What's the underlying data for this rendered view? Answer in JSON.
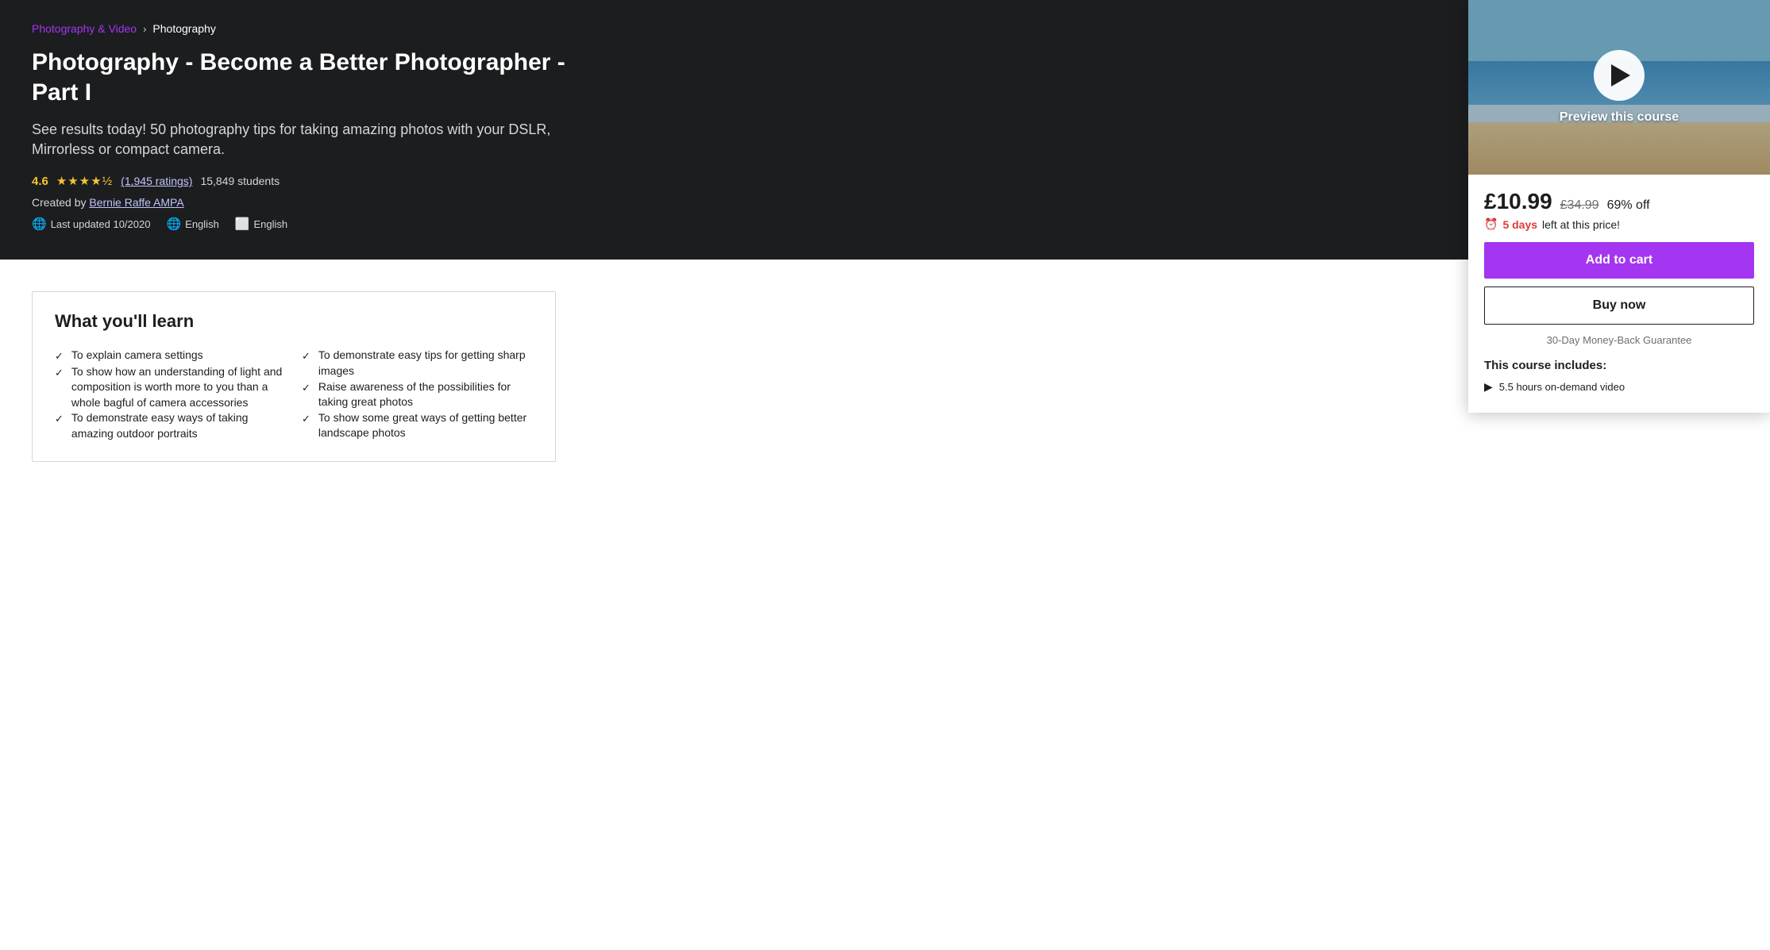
{
  "breadcrumb": {
    "parent_label": "Photography & Video",
    "separator": "›",
    "current_label": "Photography"
  },
  "course": {
    "title": "Photography - Become a Better Photographer - Part I",
    "subtitle": "See results today! 50 photography tips for taking amazing photos with your DSLR, Mirrorless or compact camera.",
    "rating_score": "4.6",
    "stars": "★★★★½",
    "rating_count": "(1,945 ratings)",
    "students": "15,849 students",
    "creator_prefix": "Created by",
    "creator_name": "Bernie Raffe AMPA",
    "last_updated_label": "Last updated 10/2020",
    "language": "English",
    "captions": "English",
    "preview_label": "Preview this course"
  },
  "pricing": {
    "current_price": "£10.99",
    "original_price": "£34.99",
    "discount": "69% off",
    "urgency_days": "5 days",
    "urgency_text": "left at this price!"
  },
  "buttons": {
    "add_to_cart": "Add to cart",
    "buy_now": "Buy now"
  },
  "guarantee": "30-Day Money-Back Guarantee",
  "includes": {
    "title": "This course includes:",
    "items": [
      {
        "icon": "▶",
        "text": "5.5 hours on-demand video"
      }
    ]
  },
  "learn_section": {
    "title": "What you'll learn",
    "items_left": [
      "To explain camera settings",
      "To show how an understanding of light and composition is worth more to you than a whole bagful of camera accessories",
      "To demonstrate easy ways of taking amazing outdoor portraits"
    ],
    "items_right": [
      "To demonstrate easy tips for getting sharp images",
      "Raise awareness of the possibilities for taking great photos",
      "To show some great ways of getting better landscape photos"
    ]
  }
}
